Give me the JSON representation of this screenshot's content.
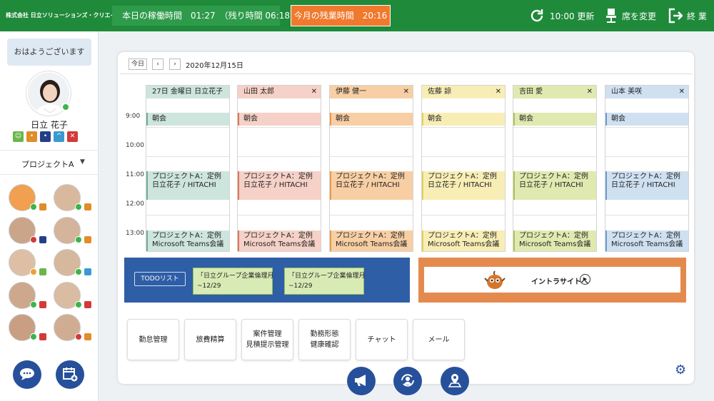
{
  "header": {
    "company": "株式会社 日立ソリューションズ・クリエイト",
    "work_time": "本日の稼働時間　01:27　（残り時間 06:18）",
    "overtime": "今月の残業時間　20:16",
    "refresh_label": "10:00 更新",
    "seat_label": "席を変更",
    "exit_label": "終 業",
    "colors": {
      "bar": "#1f8a3a",
      "overtime": "#f0792d"
    }
  },
  "sidebar": {
    "greeting": "おはようございます",
    "user_name": "日立 花子",
    "moods": [
      {
        "icon": "happy-icon",
        "color": "#6ab64a"
      },
      {
        "icon": "neutral-icon",
        "color": "#e08d2a"
      },
      {
        "icon": "sad-icon",
        "color": "#243f86"
      },
      {
        "icon": "worried-icon",
        "color": "#3a9ad0"
      },
      {
        "icon": "angry-icon",
        "color": "#d33a3a"
      }
    ],
    "project": "プロジェクトA"
  },
  "calendar": {
    "today_label": "今日",
    "date": "2020年12月15日",
    "times": [
      "9:00",
      "10:00",
      "11:00",
      "12:00",
      "13:00"
    ],
    "columns": [
      {
        "name": "27日 金曜日 日立花子",
        "color": "#cde5dc",
        "accent": "#6fae97",
        "closable": false,
        "events": [
          {
            "label1": "朝会"
          },
          {
            "label1": "プロジェクトA：定例",
            "label2": "日立花子 / HITACHI"
          },
          {
            "label1": "プロジェクトA：定例",
            "label2": "Microsoft Teams会議"
          }
        ]
      },
      {
        "name": "山田 太郎",
        "color": "#f5d1c7",
        "accent": "#d9765b",
        "closable": true,
        "events": [
          {
            "label1": "朝会"
          },
          {
            "label1": "プロジェクトA：定例",
            "label2": "日立花子 / HITACHI"
          },
          {
            "label1": "プロジェクトA：定例",
            "label2": "Microsoft Teams会議"
          }
        ]
      },
      {
        "name": "伊藤 健一",
        "color": "#f8cfa4",
        "accent": "#e89a4f",
        "closable": true,
        "events": [
          {
            "label1": "朝会"
          },
          {
            "label1": "プロジェクトA：定例",
            "label2": "日立花子 / HITACHI"
          },
          {
            "label1": "プロジェクトA：定例",
            "label2": "Microsoft Teams会議"
          }
        ]
      },
      {
        "name": "佐藤 諒",
        "color": "#f8eeb5",
        "accent": "#e3cf5a",
        "closable": true,
        "events": [
          {
            "label1": "朝会"
          },
          {
            "label1": "プロジェクトA：定例",
            "label2": "日立花子 / HITACHI"
          },
          {
            "label1": "プロジェクトA：定例",
            "label2": "Microsoft Teams会議"
          }
        ]
      },
      {
        "name": "吉田 愛",
        "color": "#e0eab0",
        "accent": "#aec357",
        "closable": true,
        "events": [
          {
            "label1": "朝会"
          },
          {
            "label1": "プロジェクトA：定例",
            "label2": "日立花子 / HITACHI"
          },
          {
            "label1": "プロジェクトA：定例",
            "label2": "Microsoft Teams会議"
          }
        ]
      },
      {
        "name": "山本 美咲",
        "color": "#cfe0f1",
        "accent": "#6f9ccd",
        "closable": true,
        "events": [
          {
            "label1": "朝会"
          },
          {
            "label1": "プロジェクトA：定例",
            "label2": "日立花子 / HITACHI"
          },
          {
            "label1": "プロジェクトA：定例",
            "label2": "Microsoft Teams会議"
          }
        ]
      }
    ]
  },
  "todo": {
    "button": "TODOリスト",
    "items": [
      {
        "title": "「日立グループ企業倫理月",
        "due": "~12/29"
      },
      {
        "title": "「日立グループ企業倫理月",
        "due": "~12/29"
      }
    ]
  },
  "banner": {
    "text": "イントラサイトへ"
  },
  "tiles": [
    {
      "line1": "勤怠管理",
      "line2": ""
    },
    {
      "line1": "旅費精算",
      "line2": ""
    },
    {
      "line1": "案件管理",
      "line2": "見積提示管理"
    },
    {
      "line1": "勤務形態",
      "line2": "健康確認"
    },
    {
      "line1": "チャット",
      "line2": ""
    },
    {
      "line1": "メール",
      "line2": ""
    }
  ]
}
